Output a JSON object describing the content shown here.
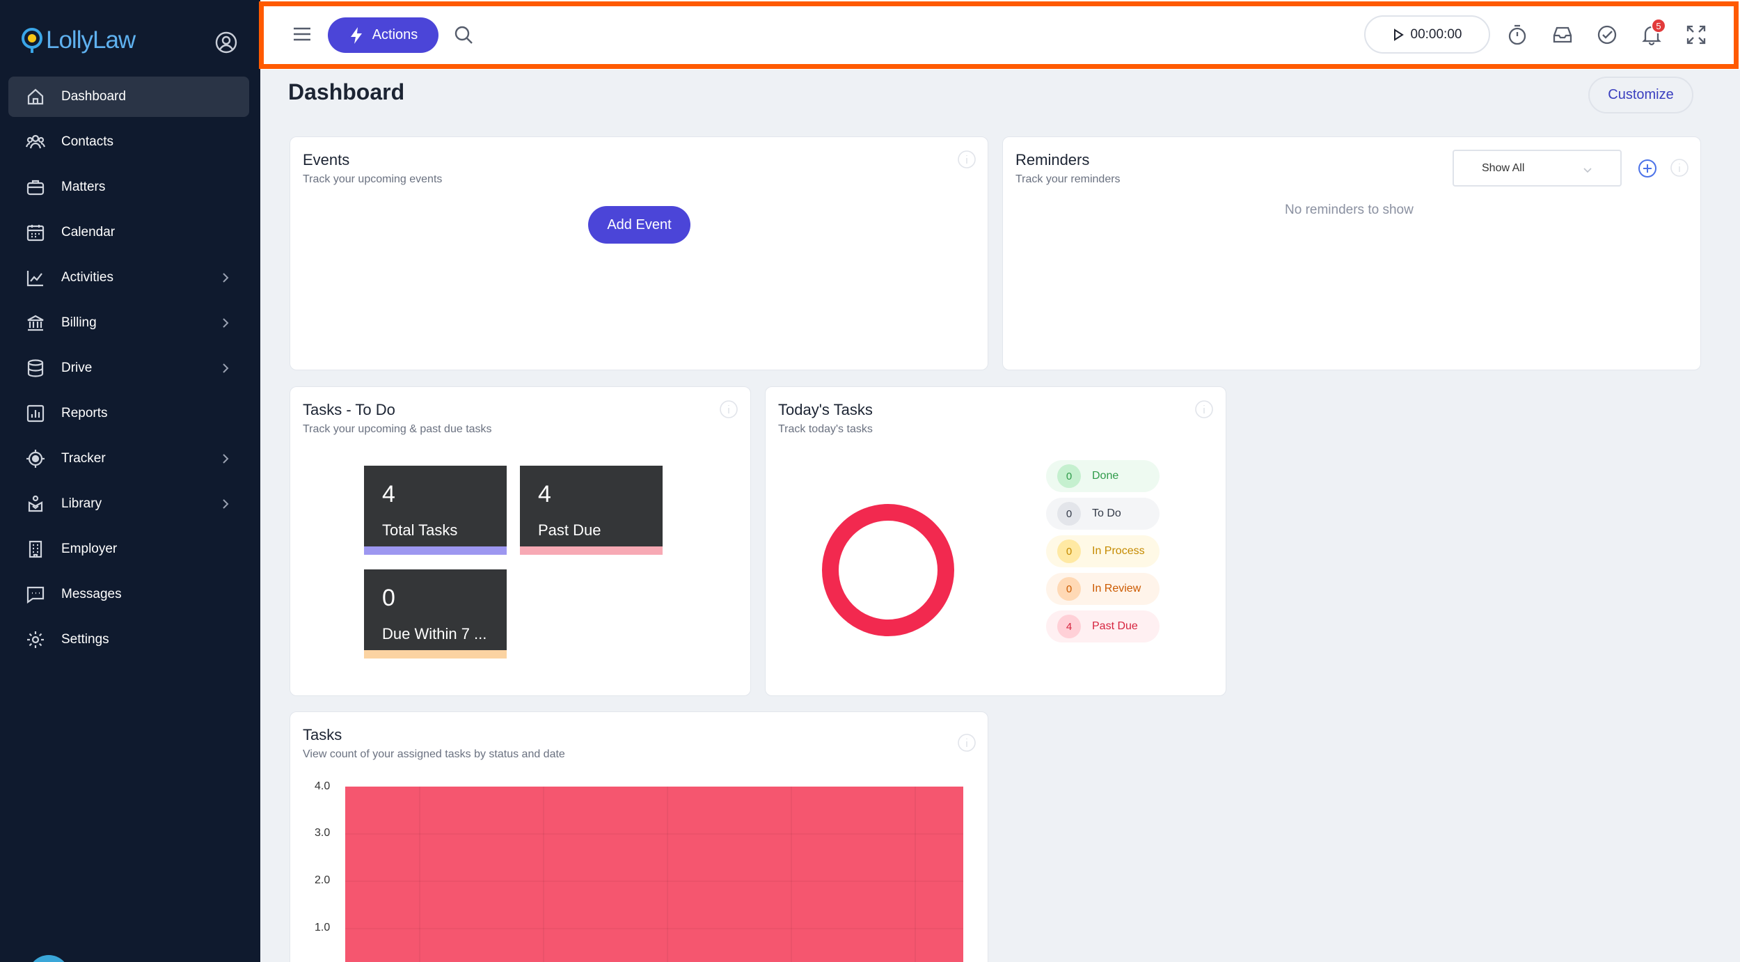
{
  "brand": {
    "name": "LollyLaw"
  },
  "sidebar": {
    "items": [
      {
        "label": "Dashboard",
        "icon": "home-icon",
        "active": true,
        "chevron": false
      },
      {
        "label": "Contacts",
        "icon": "contacts-icon",
        "chevron": false
      },
      {
        "label": "Matters",
        "icon": "briefcase-icon",
        "chevron": false
      },
      {
        "label": "Calendar",
        "icon": "calendar-icon",
        "chevron": false
      },
      {
        "label": "Activities",
        "icon": "activities-chart-icon",
        "chevron": true
      },
      {
        "label": "Billing",
        "icon": "bank-icon",
        "chevron": true
      },
      {
        "label": "Drive",
        "icon": "database-icon",
        "chevron": true
      },
      {
        "label": "Reports",
        "icon": "reports-icon",
        "chevron": false
      },
      {
        "label": "Tracker",
        "icon": "target-icon",
        "chevron": true
      },
      {
        "label": "Library",
        "icon": "library-icon",
        "chevron": true
      },
      {
        "label": "Employer",
        "icon": "building-icon",
        "chevron": false
      },
      {
        "label": "Messages",
        "icon": "message-icon",
        "chevron": false
      },
      {
        "label": "Settings",
        "icon": "settings-gear-icon",
        "chevron": false
      }
    ]
  },
  "topbar": {
    "actions_label": "Actions",
    "timer": "00:00:00",
    "notifications_count": "5",
    "icons": [
      "menu-icon",
      "bolt-icon",
      "search-icon",
      "play-icon",
      "stopwatch-icon",
      "inbox-icon",
      "check-circle-icon",
      "bell-icon",
      "fullscreen-icon"
    ]
  },
  "page": {
    "title": "Dashboard",
    "customize_label": "Customize"
  },
  "events": {
    "title": "Events",
    "subtitle": "Track your upcoming events",
    "add_label": "Add Event"
  },
  "reminders": {
    "title": "Reminders",
    "subtitle": "Track your reminders",
    "filter_value": "Show All",
    "empty": "No reminders to show"
  },
  "tasks_todo": {
    "title": "Tasks - To Do",
    "subtitle": "Track your upcoming & past due tasks",
    "tiles": [
      {
        "value": "4",
        "label": "Total Tasks",
        "color": "#9d97f0"
      },
      {
        "value": "4",
        "label": "Past Due",
        "color": "#f7a9b4"
      },
      {
        "value": "0",
        "label": "Due Within 7 ...",
        "color": "#fbd3a2"
      }
    ]
  },
  "todays_tasks": {
    "title": "Today's Tasks",
    "subtitle": "Track today's tasks",
    "donut_color": "#f2294f",
    "legend": [
      {
        "count": "0",
        "label": "Done",
        "bg": "#eefaf1",
        "dot": "#c5f0cf",
        "text": "#2f9b4a"
      },
      {
        "count": "0",
        "label": "To Do",
        "bg": "#f4f5f7",
        "dot": "#e3e5ea",
        "text": "#333a48"
      },
      {
        "count": "0",
        "label": "In Process",
        "bg": "#fff9e6",
        "dot": "#ffe9a3",
        "text": "#c58a00"
      },
      {
        "count": "0",
        "label": "In Review",
        "bg": "#fff4ea",
        "dot": "#ffd9b5",
        "text": "#cc5a00"
      },
      {
        "count": "4",
        "label": "Past Due",
        "bg": "#fff0f2",
        "dot": "#ffd0d7",
        "text": "#d6243f"
      }
    ]
  },
  "tasks_chart": {
    "title": "Tasks",
    "subtitle": "View count of your assigned tasks by status and date"
  },
  "chart_data": {
    "type": "area",
    "ylim": [
      0,
      4
    ],
    "yticks": [
      "4.0",
      "3.0",
      "2.0",
      "1.0"
    ],
    "series": [
      {
        "values": [
          4,
          4,
          4,
          4,
          4,
          4
        ]
      }
    ],
    "color": "#f5566f"
  }
}
